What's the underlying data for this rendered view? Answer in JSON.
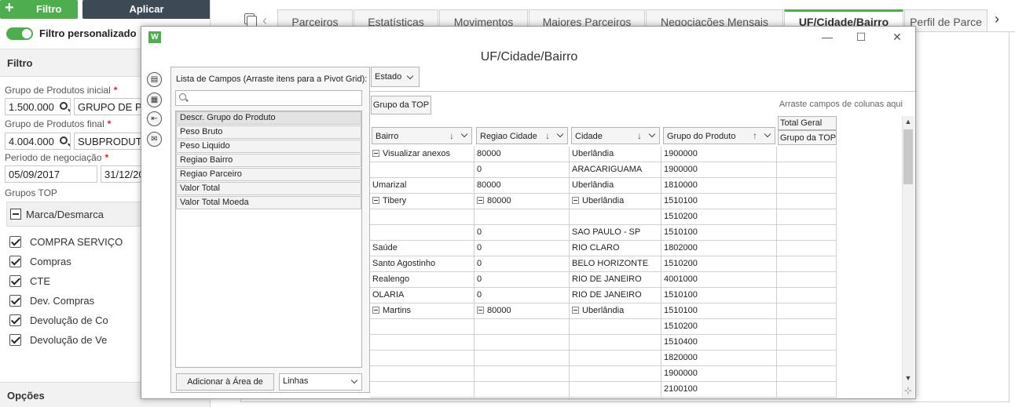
{
  "left": {
    "filter_button": "Filtro",
    "apply_button": "Aplicar",
    "custom_filter_label": "Filtro personalizado",
    "section_title": "Filtro",
    "grupo_inicial_label": "Grupo de Produtos inicial",
    "grupo_inicial_code": "1.500.000",
    "grupo_inicial_desc": "GRUPO DE P",
    "grupo_final_label": "Grupo de Produtos final",
    "grupo_final_code": "4.004.000",
    "grupo_final_desc": "SUBPRODUT",
    "periodo_label": "Período de negociação",
    "periodo_inicio": "05/09/2017",
    "periodo_fim": "31/12/20",
    "grupos_top_label": "Grupos TOP",
    "marca_desmarca": "Marca/Desmarca",
    "checkbox_items": [
      "COMPRA SERVIÇO",
      "Compras",
      "CTE",
      "Dev. Compras",
      "Devolução de Co",
      "Devolução de Ve"
    ],
    "options_label": "Opções",
    "required_mark": "*"
  },
  "tabs": [
    "Parceiros",
    "Estatísticas",
    "Movimentos",
    "Maiores Parceiros",
    "Negociações Mensais",
    "UF/Cidade/Bairro",
    "Perfil de Parce"
  ],
  "active_tab": "UF/Cidade/Bairro",
  "dialog": {
    "app_icon_letter": "W",
    "title": "UF/Cidade/Bairro",
    "minimize": "—",
    "maximize": "☐",
    "close": "✕",
    "field_list_title": "Lista de Campos (Arraste itens para a Pivot Grid):",
    "search_placeholder": "",
    "fields": [
      "Descr. Grupo do Produto",
      "Peso Bruto",
      "Peso Liquido",
      "Regiao Bairro",
      "Regiao Parceiro",
      "Valor Total",
      "Valor Total Moeda"
    ],
    "add_button": "Adicionar à Área de",
    "area_select": "Linhas"
  },
  "pivot": {
    "filter_field": "Estado",
    "column_field": "Grupo da TOP",
    "column_hint": "Arraste campos de colunas aqui",
    "row_headers": [
      "Bairro",
      "Regiao Cidade",
      "Cidade",
      "Grupo do Produto"
    ],
    "total_header": "Total Geral",
    "total_sub": "Grupo da TOP",
    "rows": [
      {
        "bairro": "Visualizar anexos",
        "bairro_exp": true,
        "regiao": "80000",
        "regiao_exp": false,
        "cidade": "Uberlândia",
        "cidade_exp": false,
        "grupo": "1900000"
      },
      {
        "bairro": "",
        "regiao": "0",
        "cidade": "ARACARIGUAMA",
        "grupo": "1900000"
      },
      {
        "bairro": "Umarizal",
        "regiao": "80000",
        "cidade": "Uberlândia",
        "grupo": "1810000"
      },
      {
        "bairro": "Tibery",
        "bairro_exp": true,
        "regiao": "80000",
        "regiao_exp": true,
        "cidade": "Uberlândia",
        "cidade_exp": true,
        "grupo": "1510100"
      },
      {
        "bairro": "",
        "regiao": "",
        "cidade": "",
        "grupo": "1510200"
      },
      {
        "bairro": "",
        "regiao": "0",
        "cidade": "SAO PAULO - SP",
        "grupo": "1510100"
      },
      {
        "bairro": "Saúde",
        "regiao": "0",
        "cidade": "RIO CLARO",
        "grupo": "1802000"
      },
      {
        "bairro": "Santo Agostinho",
        "regiao": "0",
        "cidade": "BELO HORIZONTE",
        "grupo": "1510200"
      },
      {
        "bairro": "Realengo",
        "regiao": "0",
        "cidade": "RIO DE JANEIRO",
        "grupo": "4001000"
      },
      {
        "bairro": "OLARIA",
        "regiao": "0",
        "cidade": "RIO DE JANEIRO",
        "grupo": "1510100"
      },
      {
        "bairro": "Martins",
        "bairro_exp": true,
        "regiao": "80000",
        "regiao_exp": true,
        "cidade": "Uberlândia",
        "cidade_exp": true,
        "grupo": "1510100"
      },
      {
        "bairro": "",
        "regiao": "",
        "cidade": "",
        "grupo": "1510200"
      },
      {
        "bairro": "",
        "regiao": "",
        "cidade": "",
        "grupo": "1510400"
      },
      {
        "bairro": "",
        "regiao": "",
        "cidade": "",
        "grupo": "1820000"
      },
      {
        "bairro": "",
        "regiao": "",
        "cidade": "",
        "grupo": "1900000"
      },
      {
        "bairro": "",
        "regiao": "",
        "cidade": "",
        "grupo": "2100100"
      }
    ]
  },
  "colors": {
    "accent": "#4cae4c",
    "dark_button": "#3d4a56",
    "required": "#d9251d"
  }
}
